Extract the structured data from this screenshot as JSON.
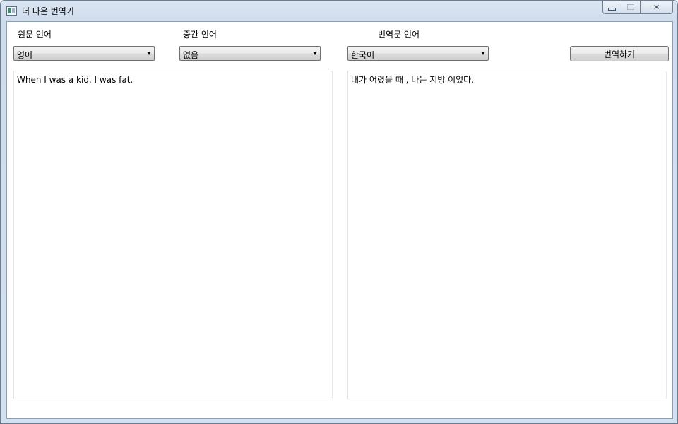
{
  "window": {
    "title": "더 나은 번역기",
    "controls": {
      "minimize_icon": "minimize-icon",
      "maximize_icon": "maximize-icon",
      "close_glyph": "✕"
    }
  },
  "labels": {
    "source_language": "원문 언어",
    "pivot_language": "중간 언어",
    "target_language": "번역문 언어"
  },
  "selects": {
    "source_value": "영어",
    "pivot_value": "없음",
    "target_value": "한국어"
  },
  "translate_button": "번역하기",
  "source_text": "When I was a kid, I was fat.",
  "translated_text": "내가 어렸을 때 , 나는 지방 이었다."
}
